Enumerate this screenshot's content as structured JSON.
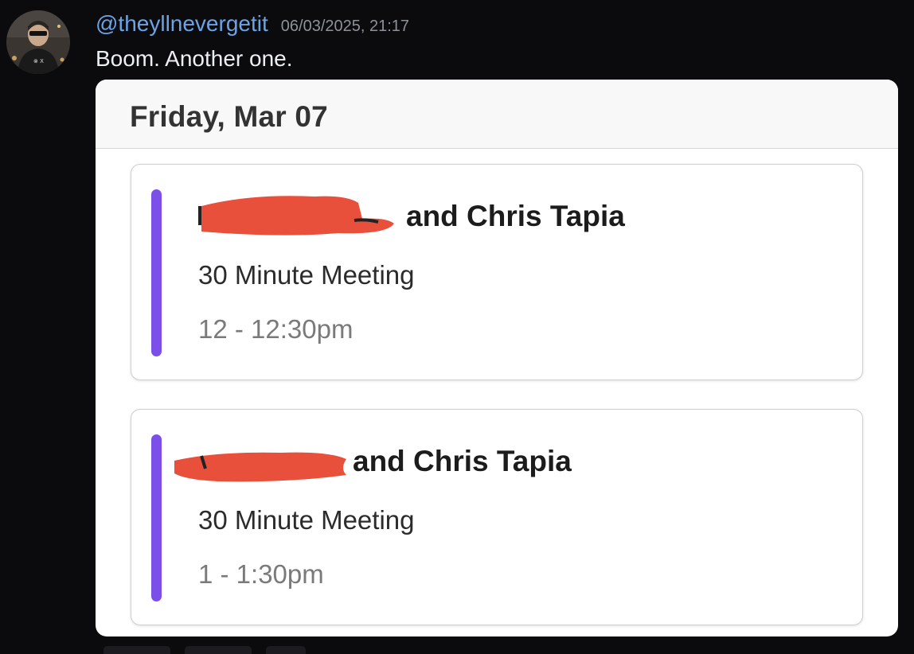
{
  "message": {
    "username": "@theyllnevergetit",
    "timestamp": "06/03/2025, 21:17",
    "content": "Boom. Another one."
  },
  "calendar": {
    "day_title": "Friday, Mar 07",
    "accent_color": "#7b4fe8",
    "redaction_color": "#e8503c",
    "events": [
      {
        "title": "and Chris Tapia",
        "type": "30 Minute Meeting",
        "time": "12 - 12:30pm"
      },
      {
        "title": "and Chris Tapia",
        "type": "30 Minute Meeting",
        "time": "1 - 1:30pm"
      }
    ]
  }
}
